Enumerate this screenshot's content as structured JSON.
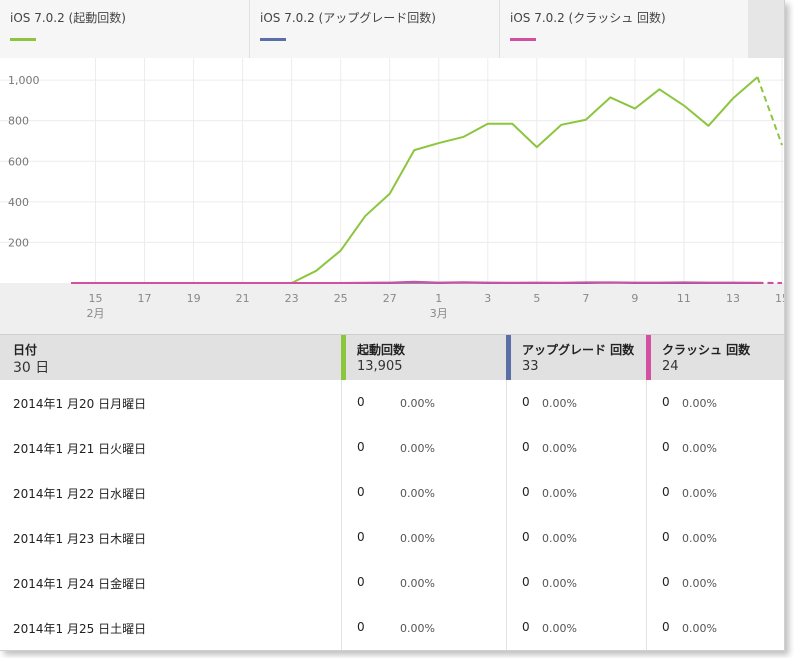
{
  "legend": [
    {
      "label": "iOS 7.0.2 (起動回数)",
      "color": "#8cc63f"
    },
    {
      "label": "iOS 7.0.2 (アップグレード回数)",
      "color": "#5b6fa6"
    },
    {
      "label": "iOS 7.0.2 (クラッシュ 回数)",
      "color": "#d34fa1"
    }
  ],
  "chart_data": {
    "type": "line",
    "x": [
      "2/14",
      "2/15",
      "2/16",
      "2/17",
      "2/18",
      "2/19",
      "2/20",
      "2/21",
      "2/22",
      "2/23",
      "2/24",
      "2/25",
      "2/26",
      "2/27",
      "2/28",
      "3/1",
      "3/2",
      "3/3",
      "3/4",
      "3/5",
      "3/6",
      "3/7",
      "3/8",
      "3/9",
      "3/10",
      "3/11",
      "3/12",
      "3/13",
      "3/14",
      "3/15"
    ],
    "x_tick_labels": [
      "15",
      "17",
      "19",
      "21",
      "23",
      "25",
      "27",
      "1",
      "3",
      "5",
      "7",
      "9",
      "11",
      "13",
      "15"
    ],
    "x_month_labels": [
      "2月",
      "3月"
    ],
    "y_ticks": [
      "200",
      "400",
      "600",
      "800",
      "1,000"
    ],
    "ylim": [
      0,
      1060
    ],
    "grid": true,
    "series": [
      {
        "name": "iOS 7.0.2 (起動回数)",
        "color": "#8cc63f",
        "values": [
          0,
          0,
          0,
          0,
          0,
          0,
          0,
          0,
          0,
          0,
          60,
          160,
          330,
          440,
          655,
          690,
          720,
          785,
          785,
          670,
          780,
          805,
          915,
          860,
          955,
          875,
          775,
          910,
          1015,
          680
        ],
        "dashed_last_segment": true
      },
      {
        "name": "iOS 7.0.2 (アップグレード回数)",
        "color": "#5b6fa6",
        "values": [
          0,
          0,
          0,
          0,
          0,
          0,
          0,
          0,
          0,
          0,
          0,
          0,
          0,
          0,
          2,
          0,
          2,
          0,
          0,
          0,
          0,
          0,
          2,
          0,
          0,
          0,
          0,
          0,
          0,
          0
        ],
        "dashed_last_segment": true
      },
      {
        "name": "iOS 7.0.2 (クラッシュ 回数)",
        "color": "#d34fa1",
        "values": [
          0,
          0,
          0,
          0,
          0,
          0,
          0,
          0,
          0,
          0,
          0,
          0,
          1,
          2,
          6,
          2,
          4,
          2,
          1,
          2,
          1,
          3,
          3,
          2,
          2,
          3,
          2,
          2,
          1,
          0
        ],
        "dashed_last_segment": true
      }
    ]
  },
  "table": {
    "headers": {
      "date": {
        "title": "日付",
        "value": "30 日"
      },
      "launches": {
        "title": "起動回数",
        "value": "13,905",
        "color": "#8cc63f"
      },
      "upgrades": {
        "title": "アップグレード 回数",
        "value": "33",
        "color": "#5b6fa6"
      },
      "crashes": {
        "title": "クラッシュ 回数",
        "value": "24",
        "color": "#d34fa1"
      }
    },
    "rows": [
      {
        "date": "2014年1 月20 日月曜日",
        "launches": "0",
        "launches_pct": "0.00%",
        "upgrades": "0",
        "upgrades_pct": "0.00%",
        "crashes": "0",
        "crashes_pct": "0.00%"
      },
      {
        "date": "2014年1 月21 日火曜日",
        "launches": "0",
        "launches_pct": "0.00%",
        "upgrades": "0",
        "upgrades_pct": "0.00%",
        "crashes": "0",
        "crashes_pct": "0.00%"
      },
      {
        "date": "2014年1 月22 日水曜日",
        "launches": "0",
        "launches_pct": "0.00%",
        "upgrades": "0",
        "upgrades_pct": "0.00%",
        "crashes": "0",
        "crashes_pct": "0.00%"
      },
      {
        "date": "2014年1 月23 日木曜日",
        "launches": "0",
        "launches_pct": "0.00%",
        "upgrades": "0",
        "upgrades_pct": "0.00%",
        "crashes": "0",
        "crashes_pct": "0.00%"
      },
      {
        "date": "2014年1 月24 日金曜日",
        "launches": "0",
        "launches_pct": "0.00%",
        "upgrades": "0",
        "upgrades_pct": "0.00%",
        "crashes": "0",
        "crashes_pct": "0.00%"
      },
      {
        "date": "2014年1 月25 日土曜日",
        "launches": "0",
        "launches_pct": "0.00%",
        "upgrades": "0",
        "upgrades_pct": "0.00%",
        "crashes": "0",
        "crashes_pct": "0.00%"
      }
    ]
  }
}
